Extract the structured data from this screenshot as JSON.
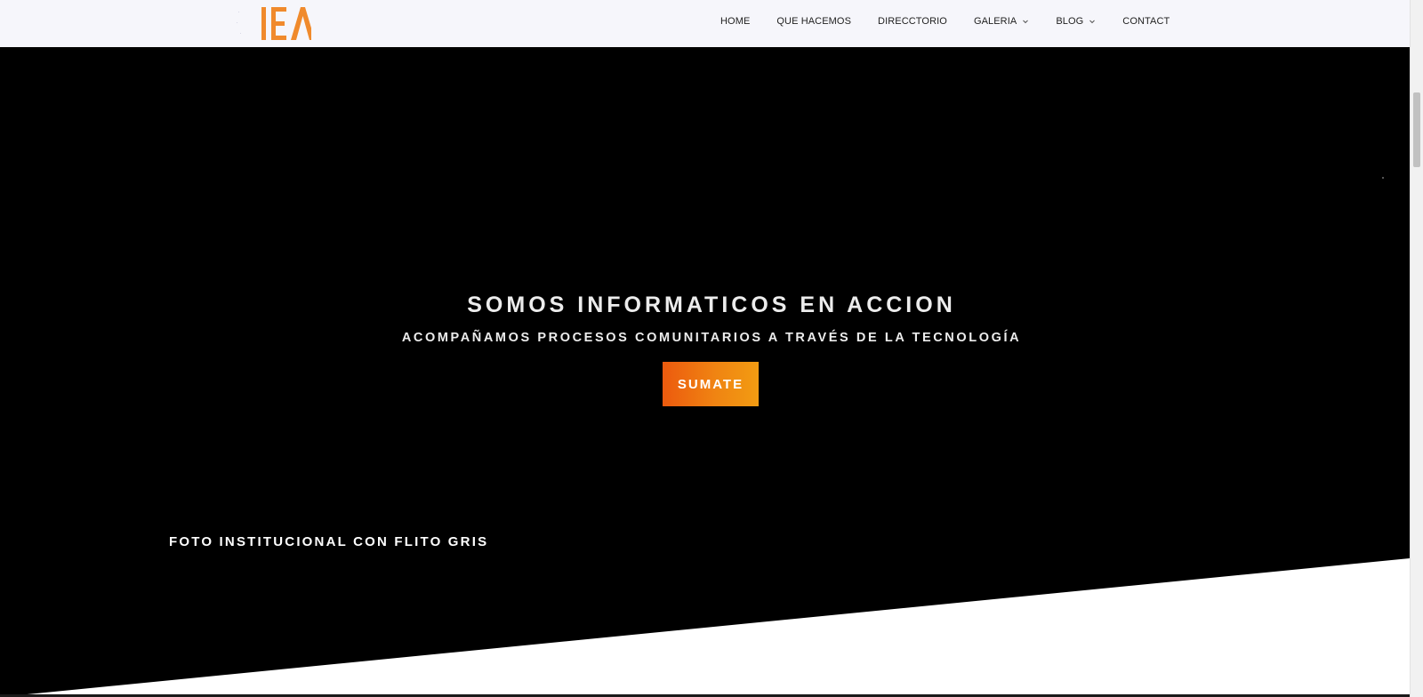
{
  "header": {
    "logo_text": "IEA",
    "nav": [
      {
        "label": "HOME",
        "has_dropdown": false
      },
      {
        "label": "QUE HACEMOS",
        "has_dropdown": false
      },
      {
        "label": "DIRECCTORIO",
        "has_dropdown": false
      },
      {
        "label": "GALERIA",
        "has_dropdown": true
      },
      {
        "label": "BLOG",
        "has_dropdown": true
      },
      {
        "label": "CONTACT",
        "has_dropdown": false
      }
    ]
  },
  "hero": {
    "title": "SOMOS INFORMATICOS EN ACCION",
    "subtitle": "ACOMPAÑAMOS PROCESOS COMUNITARIOS A TRAVÉS DE LA TECNOLOGÍA",
    "cta_label": "SUMATE",
    "caption": "FOTO INSTITUCIONAL CON FLITO GRIS"
  },
  "colors": {
    "brand_orange": "#f08a2c",
    "cta_gradient_start": "#ec5a0e",
    "cta_gradient_end": "#f29c12",
    "hero_background": "#000000",
    "header_background": "#f6f6fb"
  },
  "icons": {
    "dropdown": "chevron-down-icon"
  }
}
